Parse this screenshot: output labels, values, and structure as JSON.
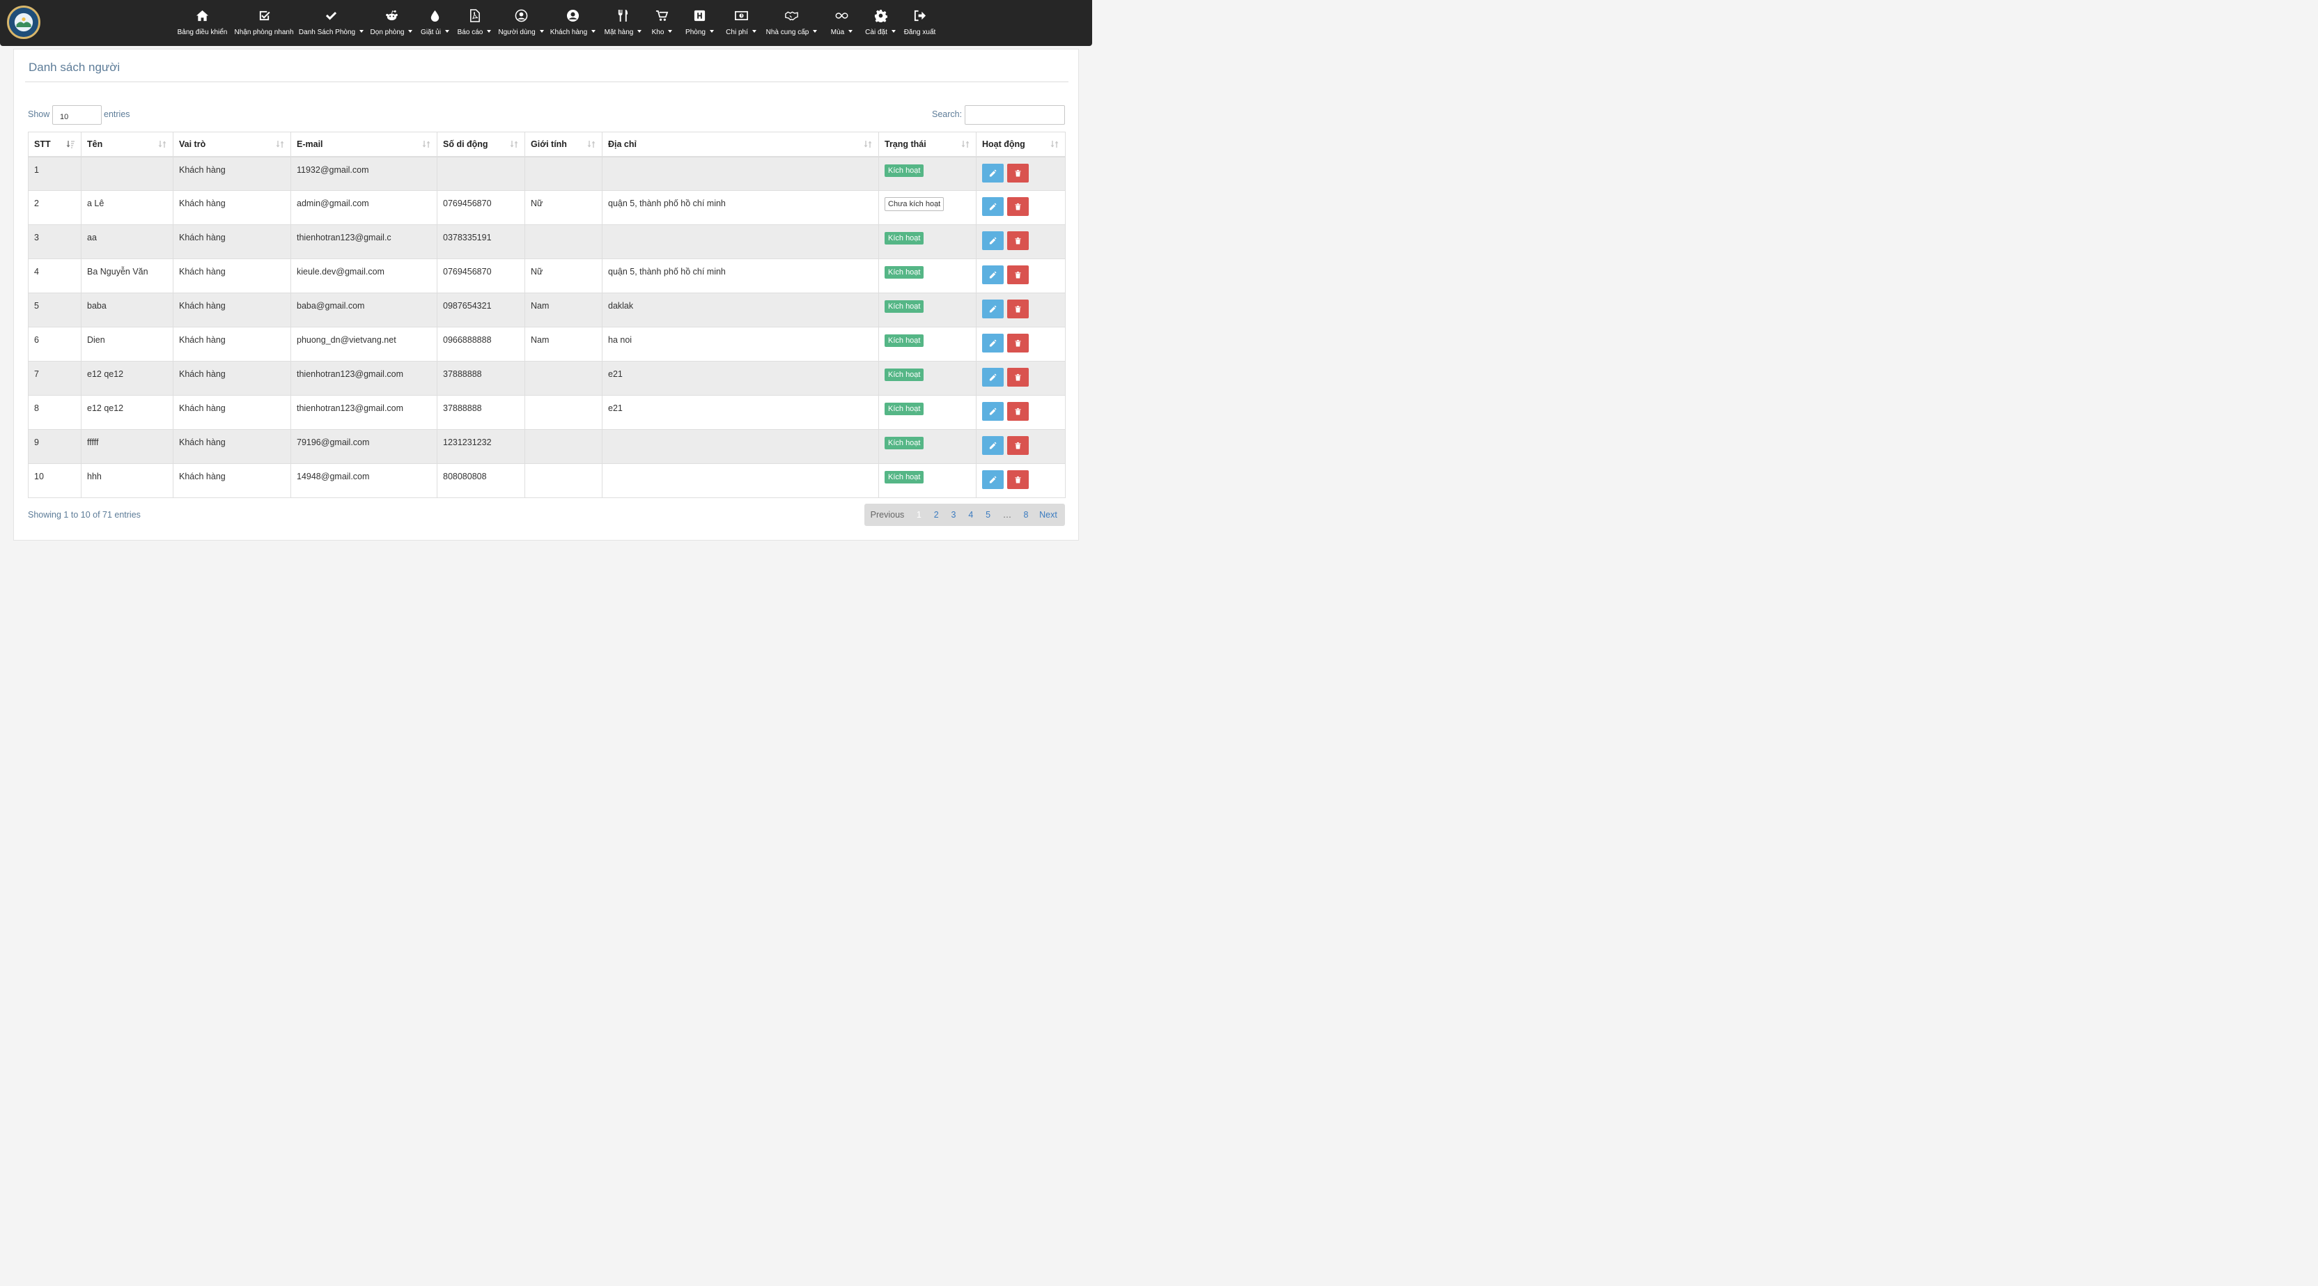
{
  "brand": {
    "logo_text": "TRAVEL AGENT KIMBERIO"
  },
  "nav": [
    {
      "icon": "home",
      "label": "Bảng điều khiển",
      "dropdown": false
    },
    {
      "icon": "check-square",
      "label": "Nhận phòng nhanh",
      "dropdown": false
    },
    {
      "icon": "check",
      "label": "Danh Sách Phòng",
      "dropdown": true
    },
    {
      "icon": "reddit",
      "label": "Dọn phòng",
      "dropdown": true
    },
    {
      "icon": "tint",
      "label": "Giặt ủi",
      "dropdown": true
    },
    {
      "icon": "file-pdf",
      "label": "Báo cáo",
      "dropdown": true
    },
    {
      "icon": "user-circle",
      "label": "Người dùng",
      "dropdown": true
    },
    {
      "icon": "user-circle-filled",
      "label": "Khách hàng",
      "dropdown": true
    },
    {
      "icon": "utensils",
      "label": "Mặt hàng",
      "dropdown": true
    },
    {
      "icon": "cart",
      "label": "Kho",
      "dropdown": true
    },
    {
      "icon": "hospital",
      "label": "Phòng",
      "dropdown": true
    },
    {
      "icon": "money-bill",
      "label": "Chi phí",
      "dropdown": true
    },
    {
      "icon": "handshake",
      "label": "Nhà cung cấp",
      "dropdown": true
    },
    {
      "icon": "infinity",
      "label": "Mùa",
      "dropdown": true
    },
    {
      "icon": "cog",
      "label": "Cài đặt",
      "dropdown": true
    },
    {
      "icon": "sign-out",
      "label": "Đăng xuất",
      "dropdown": false
    }
  ],
  "page": {
    "title": "Danh sách người"
  },
  "length": {
    "show": "Show",
    "value": "10",
    "entries": "entries"
  },
  "search": {
    "label": "Search:",
    "value": ""
  },
  "table": {
    "columns": [
      "STT",
      "Tên",
      "Vai trò",
      "E-mail",
      "Số di động",
      "Giới tính",
      "Địa chỉ",
      "Trạng thái",
      "Hoạt động"
    ],
    "rows": [
      {
        "stt": "1",
        "name": "",
        "role": "Khách hàng",
        "email": "11932@gmail.com",
        "phone": "",
        "gender": "",
        "address": "",
        "status": "Kích hoạt",
        "active": true
      },
      {
        "stt": "2",
        "name": "a Lê",
        "role": "Khách hàng",
        "email": "admin@gmail.com",
        "phone": "0769456870",
        "gender": "Nữ",
        "address": "quận 5, thành phố hồ chí minh",
        "status": "Chưa kích hoạt",
        "active": false
      },
      {
        "stt": "3",
        "name": "aa",
        "role": "Khách hàng",
        "email": "thienhotran123@gmail.c",
        "phone": "0378335191",
        "gender": "",
        "address": "",
        "status": "Kích hoạt",
        "active": true
      },
      {
        "stt": "4",
        "name": "Ba Nguyễn Văn",
        "role": "Khách hàng",
        "email": "kieule.dev@gmail.com",
        "phone": "0769456870",
        "gender": "Nữ",
        "address": "quận 5, thành phố hồ chí minh",
        "status": "Kích hoạt",
        "active": true
      },
      {
        "stt": "5",
        "name": "baba",
        "role": "Khách hàng",
        "email": "baba@gmail.com",
        "phone": "0987654321",
        "gender": "Nam",
        "address": "daklak",
        "status": "Kích hoạt",
        "active": true
      },
      {
        "stt": "6",
        "name": "Dien",
        "role": "Khách hàng",
        "email": "phuong_dn@vietvang.net",
        "phone": "0966888888",
        "gender": "Nam",
        "address": "ha noi",
        "status": "Kích hoạt",
        "active": true
      },
      {
        "stt": "7",
        "name": "e12 qe12",
        "role": "Khách hàng",
        "email": "thienhotran123@gmail.com",
        "phone": "37888888",
        "gender": "",
        "address": "e21",
        "status": "Kích hoạt",
        "active": true
      },
      {
        "stt": "8",
        "name": "e12 qe12",
        "role": "Khách hàng",
        "email": "thienhotran123@gmail.com",
        "phone": "37888888",
        "gender": "",
        "address": "e21",
        "status": "Kích hoạt",
        "active": true
      },
      {
        "stt": "9",
        "name": "fffff",
        "role": "Khách hàng",
        "email": "79196@gmail.com",
        "phone": "1231231232",
        "gender": "",
        "address": "",
        "status": "Kích hoạt",
        "active": true
      },
      {
        "stt": "10",
        "name": "hhh",
        "role": "Khách hàng",
        "email": "14948@gmail.com",
        "phone": "808080808",
        "gender": "",
        "address": "",
        "status": "Kích hoạt",
        "active": true
      }
    ]
  },
  "info": "Showing 1 to 10 of 71 entries",
  "pagination": {
    "previous": "Previous",
    "pages": [
      "1",
      "2",
      "3",
      "4",
      "5"
    ],
    "current": "1",
    "ellipsis": "…",
    "last": "8",
    "next": "Next"
  },
  "colors": {
    "navbar": "#262626",
    "active_badge": "#55b686",
    "edit_button": "#5cb0e0",
    "delete_button": "#d9534f",
    "link": "#3c7cc0"
  }
}
